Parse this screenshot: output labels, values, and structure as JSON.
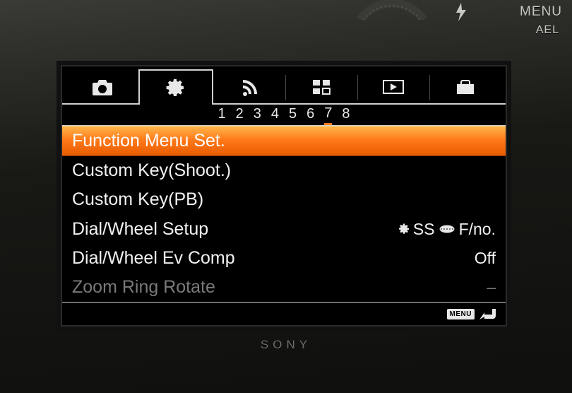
{
  "body_labels": {
    "menu": "MENU",
    "ael": "AEL",
    "brand": "SONY"
  },
  "tabs": [
    {
      "icon": "camera-icon",
      "active": false
    },
    {
      "icon": "gear-icon",
      "active": true
    },
    {
      "icon": "wifi-icon",
      "active": false
    },
    {
      "icon": "apps-icon",
      "active": false
    },
    {
      "icon": "playback-icon",
      "active": false
    },
    {
      "icon": "toolbox-icon",
      "active": false
    }
  ],
  "pager": {
    "pages": [
      "1",
      "2",
      "3",
      "4",
      "5",
      "6",
      "7",
      "8"
    ],
    "active_index": 6
  },
  "menu": [
    {
      "label": "Function Menu Set.",
      "value": "",
      "selected": true,
      "disabled": false
    },
    {
      "label": "Custom Key(Shoot.)",
      "value": "",
      "selected": false,
      "disabled": false
    },
    {
      "label": "Custom Key(PB)",
      "value": "",
      "selected": false,
      "disabled": false
    },
    {
      "label": "Dial/Wheel Setup",
      "value": "SS  F/no.",
      "selected": false,
      "disabled": false,
      "value_icons": [
        "gear-small",
        "wheel-small"
      ]
    },
    {
      "label": "Dial/Wheel Ev Comp",
      "value": "Off",
      "selected": false,
      "disabled": false
    },
    {
      "label": "Zoom Ring Rotate",
      "value": "–",
      "selected": false,
      "disabled": true
    }
  ],
  "footer": {
    "badge": "MENU"
  }
}
